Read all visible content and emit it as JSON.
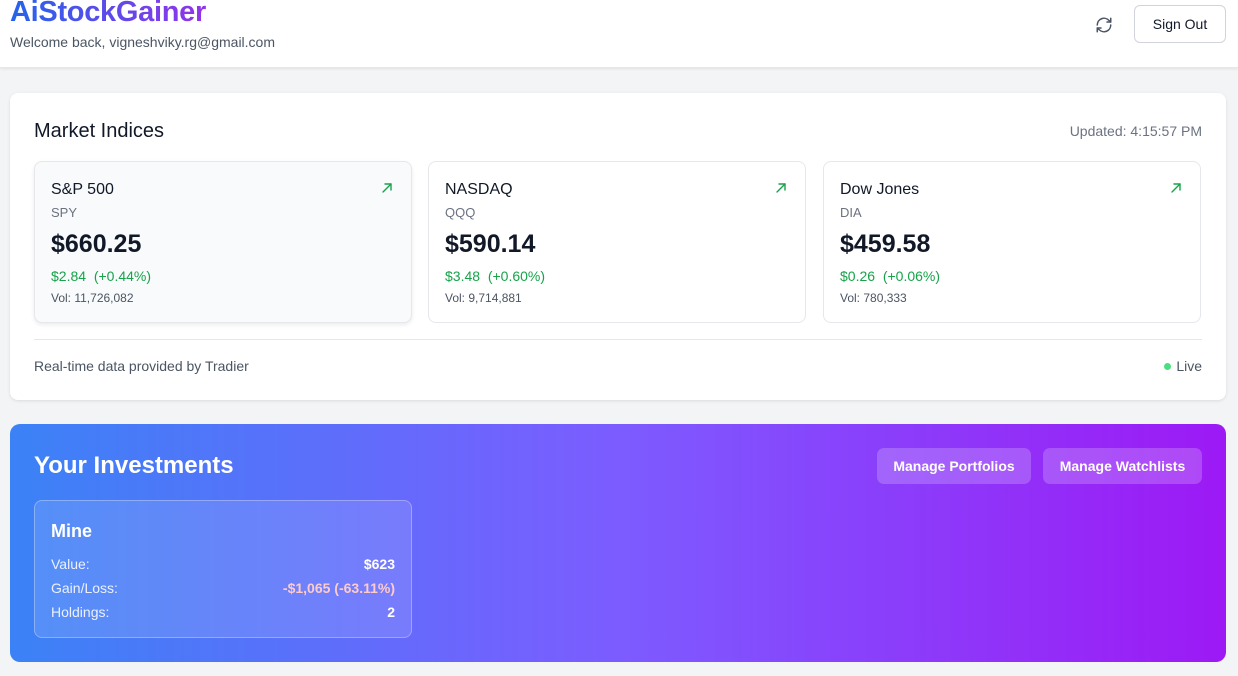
{
  "header": {
    "brand": "AiStockGainer",
    "welcome": "Welcome back, vigneshviky.rg@gmail.com",
    "refresh_icon": "refresh-icon",
    "sign_out": "Sign Out"
  },
  "market": {
    "title": "Market Indices",
    "updated": "Updated: 4:15:57 PM",
    "indices": [
      {
        "name": "S&P 500",
        "symbol": "SPY",
        "price": "$660.25",
        "change": "$2.84",
        "percent": "(+0.44%)",
        "volume": "Vol: 11,726,082",
        "trend_icon": "trending-up-icon"
      },
      {
        "name": "NASDAQ",
        "symbol": "QQQ",
        "price": "$590.14",
        "change": "$3.48",
        "percent": "(+0.60%)",
        "volume": "Vol: 9,714,881",
        "trend_icon": "trending-up-icon"
      },
      {
        "name": "Dow Jones",
        "symbol": "DIA",
        "price": "$459.58",
        "change": "$0.26",
        "percent": "(+0.06%)",
        "volume": "Vol: 780,333",
        "trend_icon": "trending-up-icon"
      }
    ],
    "provider": "Real-time data provided by Tradier",
    "live": "Live"
  },
  "investments": {
    "title": "Your Investments",
    "manage_portfolios": "Manage Portfolios",
    "manage_watchlists": "Manage Watchlists",
    "portfolio": {
      "name": "Mine",
      "value_label": "Value:",
      "value": "$623",
      "gain_label": "Gain/Loss:",
      "gain": "-$1,065 (-63.11%)",
      "holdings_label": "Holdings:",
      "holdings": "2"
    }
  },
  "colors": {
    "positive": "#16a34a",
    "brand_start": "#2563eb",
    "brand_end": "#9333ea",
    "live_dot": "#4ade80"
  }
}
